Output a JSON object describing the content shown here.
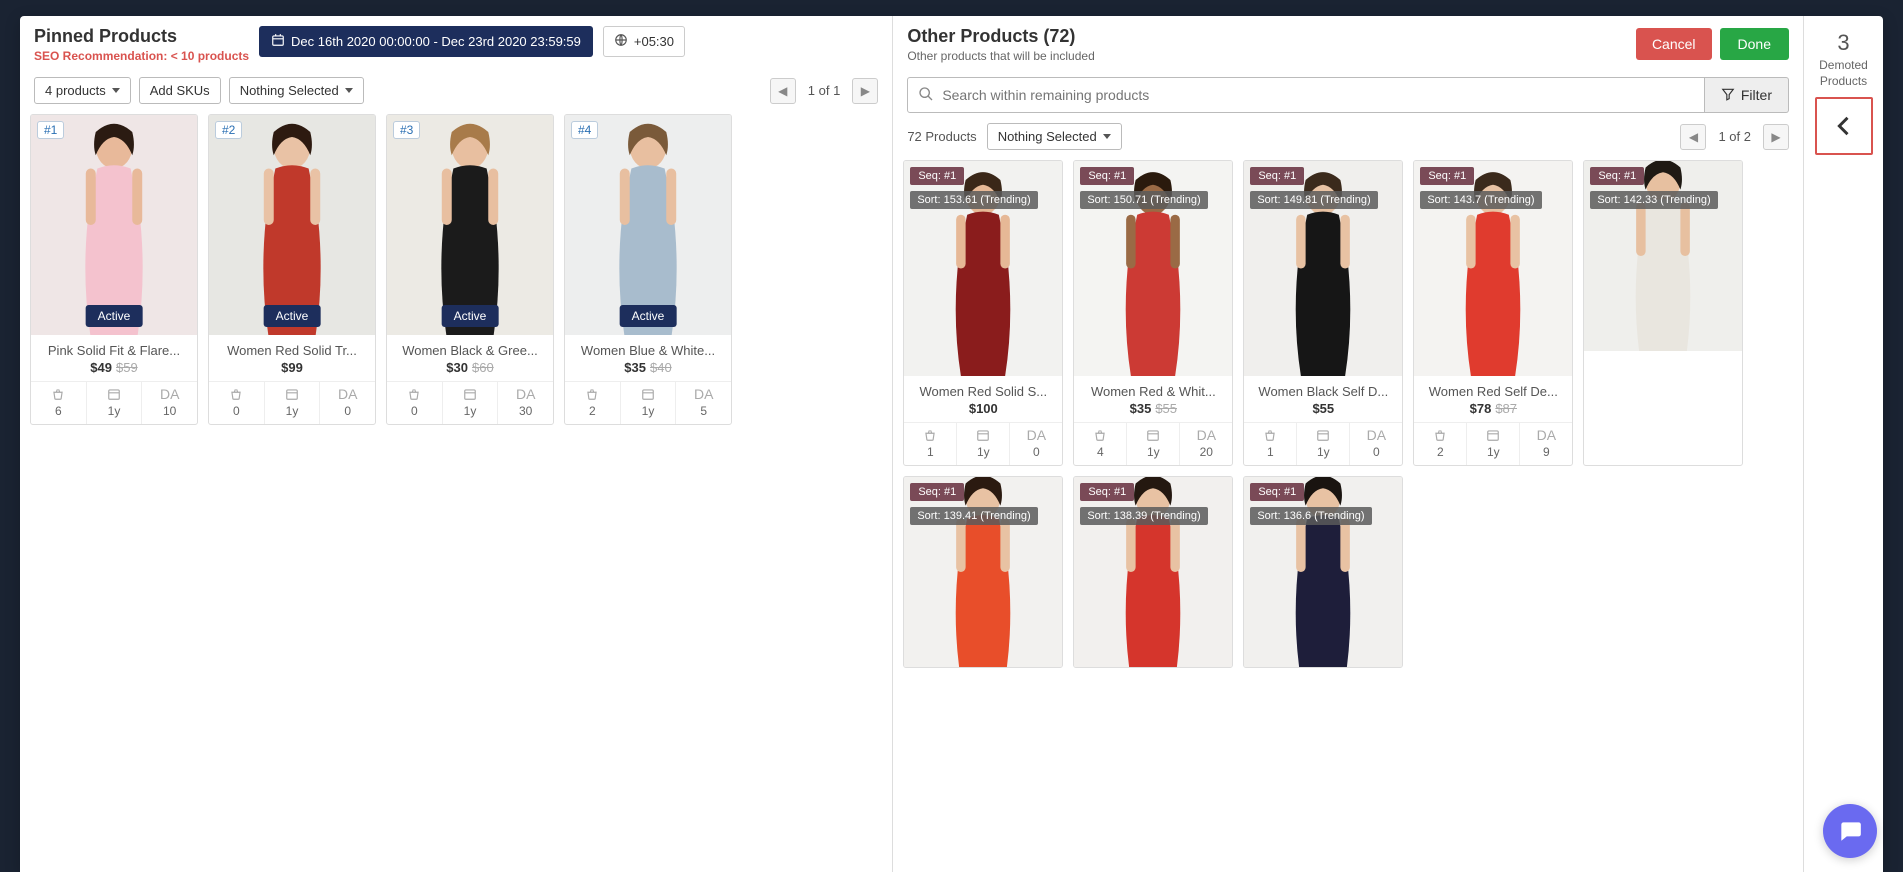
{
  "pinned": {
    "title": "Pinned Products",
    "seo_prefix": "SEO Recommendation: ",
    "seo_value": "< 10 products",
    "date_range": "Dec 16th 2020 00:00:00 - Dec 23rd 2020 23:59:59",
    "timezone": "+05:30",
    "product_count_label": "4 products",
    "add_skus_label": "Add SKUs",
    "nothing_selected_label": "Nothing Selected",
    "pager_text": "1 of 1",
    "status_label": "Active",
    "metric_da_label": "DA",
    "items": [
      {
        "rank": "#1",
        "name": "Pink Solid Fit & Flare...",
        "price": "$49",
        "old": "$59",
        "m1": "6",
        "m2": "1y",
        "m3": "10",
        "bg": "#efe6e6",
        "dress": "#f4c2ce",
        "skin": "#e8b99a",
        "hair": "#2b1b12"
      },
      {
        "rank": "#2",
        "name": "Women Red Solid Tr...",
        "price": "$99",
        "old": "",
        "m1": "0",
        "m2": "1y",
        "m3": "0",
        "bg": "#e7e7e3",
        "dress": "#c0392b",
        "skin": "#e9c2a5",
        "hair": "#2d1a10"
      },
      {
        "rank": "#3",
        "name": "Women Black & Gree...",
        "price": "$30",
        "old": "$60",
        "m1": "0",
        "m2": "1y",
        "m3": "30",
        "bg": "#eceae4",
        "dress": "#1b1b1b",
        "skin": "#e8bfa0",
        "hair": "#a87b4a"
      },
      {
        "rank": "#4",
        "name": "Women Blue & White...",
        "price": "$35",
        "old": "$40",
        "m1": "2",
        "m2": "1y",
        "m3": "5",
        "bg": "#edeeee",
        "dress": "#a8bccd",
        "skin": "#e8bfa0",
        "hair": "#7a5a3a"
      }
    ]
  },
  "other": {
    "title": "Other Products (72)",
    "subtitle": "Other products that will be included",
    "cancel": "Cancel",
    "done": "Done",
    "search_placeholder": "Search within remaining products",
    "filter_label": "Filter",
    "count_label": "72 Products",
    "nothing_selected_label": "Nothing Selected",
    "pager_text": "1 of 2",
    "metric_da_label": "DA",
    "items": [
      {
        "seq": "Seq: #1",
        "sort": "Sort: 153.61 (Trending)",
        "name": "Women Red Solid S...",
        "price": "$100",
        "old": "",
        "m1": "1",
        "m2": "1y",
        "m3": "0",
        "bg": "#f2f2f0",
        "dress": "#8a1c1c",
        "skin": "#e6b896",
        "hair": "#3a2718"
      },
      {
        "seq": "Seq: #1",
        "sort": "Sort: 150.71 (Trending)",
        "name": "Women Red & Whit...",
        "price": "$35",
        "old": "$55",
        "m1": "4",
        "m2": "1y",
        "m3": "20",
        "bg": "#f4f4f2",
        "dress": "#cc3a34",
        "skin": "#9a6a45",
        "hair": "#2a1a0d"
      },
      {
        "seq": "Seq: #1",
        "sort": "Sort: 149.81 (Trending)",
        "name": "Women Black Self D...",
        "price": "$55",
        "old": "",
        "m1": "1",
        "m2": "1y",
        "m3": "0",
        "bg": "#f0efed",
        "dress": "#161616",
        "skin": "#e8c2a3",
        "hair": "#3b2a1c"
      },
      {
        "seq": "Seq: #1",
        "sort": "Sort: 143.7 (Trending)",
        "name": "Women Red Self De...",
        "price": "$78",
        "old": "$87",
        "m1": "2",
        "m2": "1y",
        "m3": "9",
        "bg": "#f4f3f1",
        "dress": "#e03b2e",
        "skin": "#e8c2a3",
        "hair": "#3b2a1c"
      },
      {
        "seq": "Seq: #1",
        "sort": "Sort: 142.33 (Trending)",
        "name": "",
        "price": "",
        "old": "",
        "m1": "",
        "m2": "",
        "m3": "",
        "bg": "#efefec",
        "dress": "#e9e6df",
        "skin": "#e7c0a0",
        "hair": "#1f1a14"
      },
      {
        "seq": "Seq: #1",
        "sort": "Sort: 139.41 (Trending)",
        "name": "",
        "price": "",
        "old": "",
        "m1": "",
        "m2": "",
        "m3": "",
        "bg": "#f2f1ef",
        "dress": "#e84e2a",
        "skin": "#e8c2a3",
        "hair": "#2b1a10"
      },
      {
        "seq": "Seq: #1",
        "sort": "Sort: 138.39 (Trending)",
        "name": "",
        "price": "",
        "old": "",
        "m1": "",
        "m2": "",
        "m3": "",
        "bg": "#f2f0ee",
        "dress": "#d5352c",
        "skin": "#e8c2a3",
        "hair": "#241810"
      },
      {
        "seq": "Seq: #1",
        "sort": "Sort: 136.6 (Trending)",
        "name": "",
        "price": "",
        "old": "",
        "m1": "",
        "m2": "",
        "m3": "",
        "bg": "#f1f0ee",
        "dress": "#1e1e3a",
        "skin": "#e8c2a3",
        "hair": "#1a1410"
      }
    ]
  },
  "demoted": {
    "count": "3",
    "label_line1": "Demoted",
    "label_line2": "Products"
  }
}
